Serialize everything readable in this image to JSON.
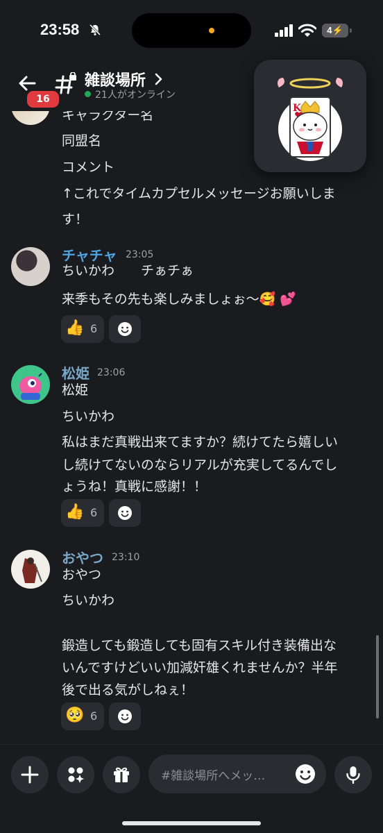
{
  "status_bar": {
    "time": "23:58",
    "battery": "4"
  },
  "header": {
    "unread_badge": "16",
    "channel_name": "雑談場所",
    "online": "21人がオンライン"
  },
  "messages": [
    {
      "lines": [
        "キャラクター名",
        "同盟名",
        "コメント",
        "↑これでタイムカプセルメッセージお願いしま",
        "す！"
      ]
    },
    {
      "author": "チャチャ",
      "author_color": "#4fa3e0",
      "time": "23:05",
      "lines": [
        "ちいかわ　　チぁチぁ",
        "来季もその先も楽しみましょぉ〜🥰 💕"
      ],
      "reaction": {
        "emoji": "👍",
        "count": "6"
      }
    },
    {
      "author": "松姫",
      "author_color": "#7aa7c7",
      "time": "23:06",
      "lines": [
        "松姫",
        "ちいかわ",
        "私はまだ真戦出来てますか？続けてたら嬉しい",
        "し続けてないのならリアルが充実してるんでし",
        "ょうね！真戦に感謝！！"
      ],
      "reaction": {
        "emoji": "👍",
        "count": "6"
      }
    },
    {
      "author": "おやつ",
      "author_color": "#7aa7c7",
      "time": "23:10",
      "lines": [
        "おやつ",
        "ちいかわ",
        "鍛造しても鍛造しても固有スキル付き装備出な",
        "いんですけどいい加減奸雄くれませんか？半年",
        "後で出る気がしねぇ！"
      ],
      "reaction": {
        "emoji": "🥺",
        "count": "6"
      }
    }
  ],
  "composer": {
    "placeholder": "#雑談場所へメッ…"
  },
  "icons": [
    "back-arrow-icon",
    "channel-hash-lock-icon",
    "plus-icon",
    "apps-icon",
    "gift-icon",
    "emoji-icon",
    "microphone-icon",
    "add-reaction-icon"
  ]
}
